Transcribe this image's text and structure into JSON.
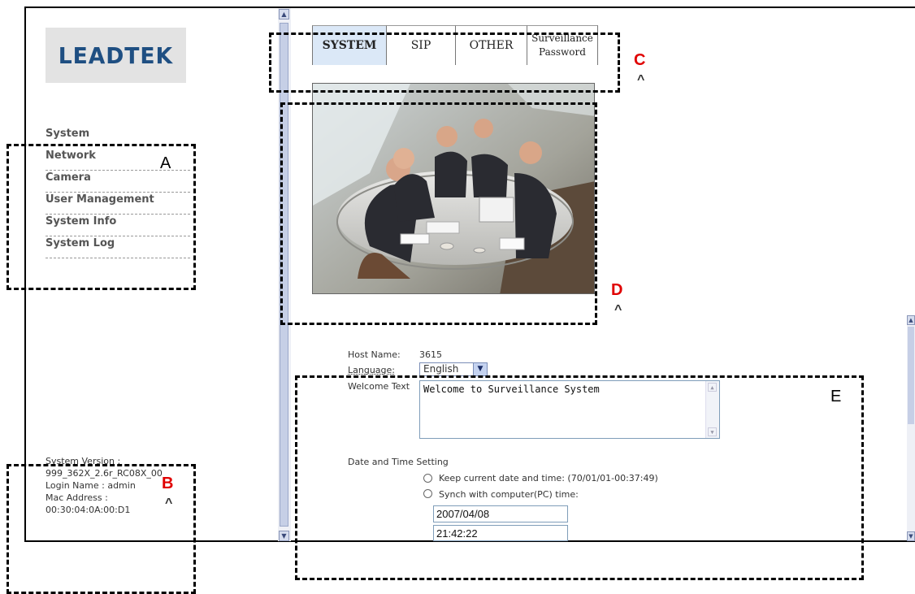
{
  "logo": {
    "text": "LEADTEK"
  },
  "menu": {
    "items": [
      "System",
      "Network",
      "Camera",
      "User Management",
      "System Info",
      "System Log"
    ]
  },
  "system_info": {
    "version_label": "System Version :",
    "version_value": "999_362X_2.6r_RC08X_00",
    "login_line": "Login Name : admin",
    "mac_label": "Mac Address :",
    "mac_value": "00:30:04:0A:00:D1"
  },
  "tabs": {
    "system": "SYSTEM",
    "sip": "SIP",
    "other": "OTHER",
    "surveillance_line1": "Surveillance",
    "surveillance_line2": "Password"
  },
  "form": {
    "host_name_label": "Host Name:",
    "host_name_value": "3615",
    "language_label": "Language:",
    "language_value": "English",
    "welcome_label": "Welcome Text",
    "welcome_value": "Welcome to Surveillance System",
    "datetime_heading": "Date and Time Setting",
    "option_keep": "Keep current date and time: (70/01/01-00:37:49)",
    "option_sync": "Synch with computer(PC) time:",
    "date_value": "2007/04/08",
    "time_value": "21:42:22"
  },
  "annotations": {
    "a": "A",
    "b": "B",
    "c": "C",
    "d": "D",
    "e": "E",
    "caret": "^"
  },
  "colors": {
    "annotation_red": "#e00000",
    "active_tab": "#dbe8f7",
    "logo_blue": "#1f4f82"
  }
}
